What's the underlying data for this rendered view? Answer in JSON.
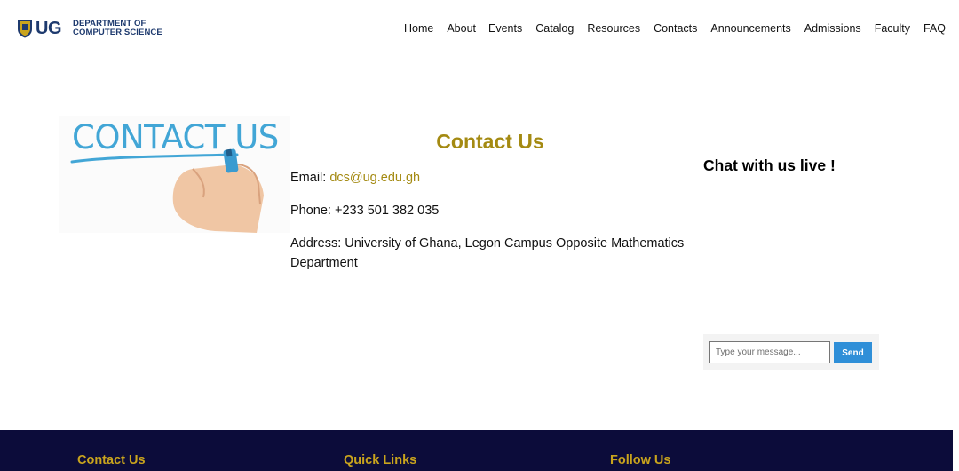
{
  "header": {
    "logo_ug": "UG",
    "logo_line1": "DEPARTMENT OF",
    "logo_line2": "COMPUTER SCIENCE",
    "nav": [
      "Home",
      "About",
      "Events",
      "Catalog",
      "Resources",
      "Contacts",
      "Announcements",
      "Admissions",
      "Faculty",
      "FAQ"
    ]
  },
  "hero_image": {
    "text": "CONTACT US"
  },
  "contact": {
    "title": "Contact Us",
    "email_label": "Email: ",
    "email_value": "dcs@ug.edu.gh",
    "phone_label": "Phone: ",
    "phone_value": "+233 501 382 035",
    "address_label": "Address: ",
    "address_value": "University of Ghana, Legon Campus Opposite Mathematics Department"
  },
  "chat": {
    "title": "Chat with us live !",
    "input_placeholder": "Type your message...",
    "send_label": "Send"
  },
  "footer": {
    "col1": "Contact Us",
    "col2": "Quick Links",
    "col3": "Follow Us"
  },
  "colors": {
    "accent_gold": "#a48a12",
    "footer_bg": "#0c0c3a",
    "footer_heading": "#c9a41d",
    "send_button": "#2f8fd8",
    "logo_blue": "#1e3a6e",
    "contact_image_text": "#42a6d6"
  }
}
